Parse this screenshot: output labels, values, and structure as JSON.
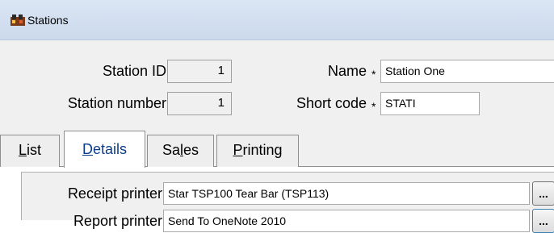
{
  "window": {
    "title": "Stations",
    "icon": "stations-app-icon"
  },
  "header": {
    "station_id_label": "Station ID",
    "station_id_value": "1",
    "station_number_label": "Station number",
    "station_number_value": "1",
    "name_label": "Name",
    "name_value": "Station One",
    "short_code_label": "Short code",
    "short_code_value": "STATI",
    "required_marker": "*"
  },
  "tabs": [
    {
      "label_pre": "",
      "label_u": "L",
      "label_post": "ist",
      "active": false
    },
    {
      "label_pre": "",
      "label_u": "D",
      "label_post": "etails",
      "active": true
    },
    {
      "label_pre": "Sa",
      "label_u": "l",
      "label_post": "es",
      "active": false
    },
    {
      "label_pre": "",
      "label_u": "P",
      "label_post": "rinting",
      "active": false
    }
  ],
  "details": {
    "receipt_printer_label": "Receipt printer",
    "receipt_printer_value": "Star TSP100 Tear Bar (TSP113)",
    "report_printer_label": "Report printer",
    "report_printer_value": "Send To OneNote 2010",
    "browse_label": "..."
  }
}
